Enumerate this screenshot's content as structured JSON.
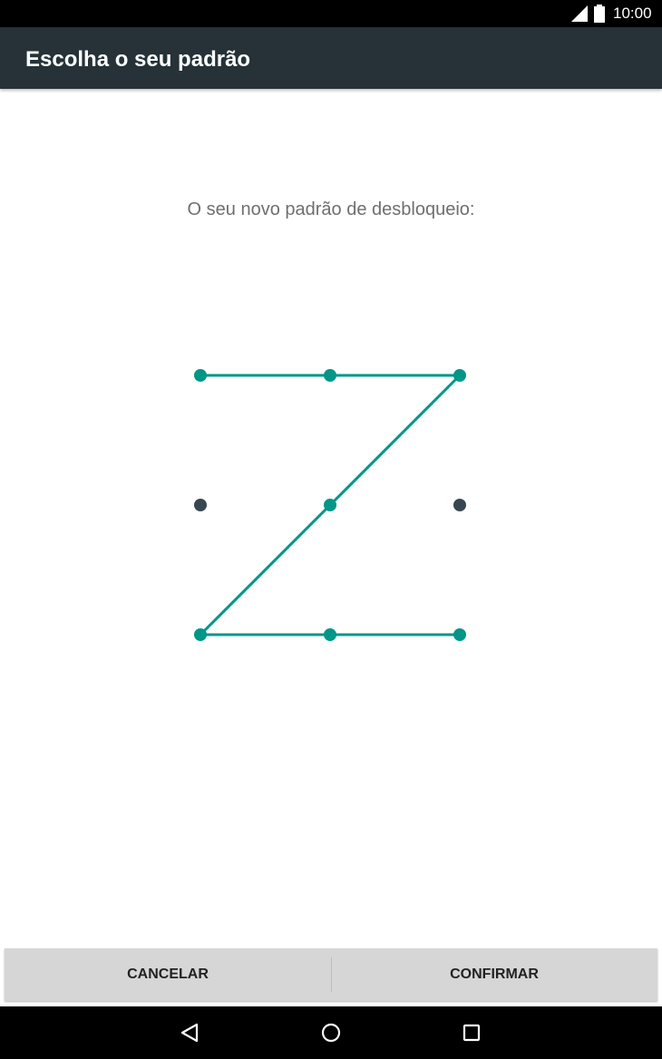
{
  "status_bar": {
    "time": "10:00",
    "icons": [
      "signal-icon",
      "battery-icon"
    ]
  },
  "app_bar": {
    "title": "Escolha o seu padrão"
  },
  "main": {
    "prompt": "O seu novo padrão de desbloqueio:",
    "pattern": {
      "grid_size": 3,
      "active_color": "#009688",
      "inactive_color": "#37474f",
      "sequence": [
        1,
        2,
        3,
        5,
        7,
        8,
        9
      ],
      "inactive_dots": [
        4,
        6
      ]
    }
  },
  "buttons": {
    "cancel_label": "CANCELAR",
    "confirm_label": "CONFIRMAR"
  },
  "nav_bar": {
    "icons": [
      "back-icon",
      "home-icon",
      "recents-icon"
    ]
  },
  "colors": {
    "status_bar": "#000000",
    "app_bar": "#263238",
    "button_bar": "#d6d6d6",
    "nav_bar": "#000000"
  }
}
